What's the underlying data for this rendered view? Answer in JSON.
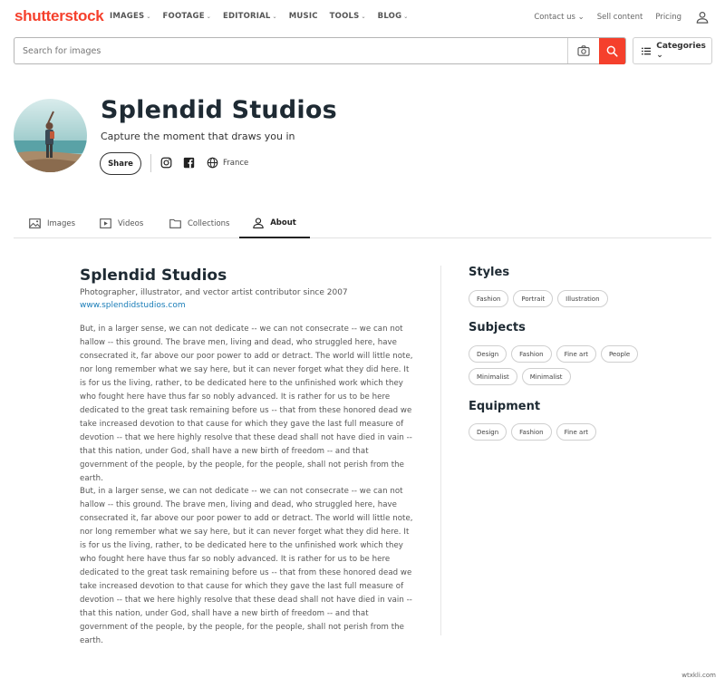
{
  "nav": {
    "logo": "shutterstock",
    "links": [
      {
        "label": "IMAGES",
        "caret": "⌄"
      },
      {
        "label": "FOOTAGE",
        "caret": "⌄"
      },
      {
        "label": "EDITORIAL",
        "caret": "⌄"
      },
      {
        "label": "MUSIC",
        "caret": ""
      },
      {
        "label": "TOOLS",
        "caret": "⌄"
      },
      {
        "label": "BLOG",
        "caret": "⌄"
      }
    ],
    "right": {
      "contact": "Contact us ⌄",
      "sell": "Sell content",
      "pricing": "Pricing"
    },
    "user_icon": "user-icon"
  },
  "search": {
    "placeholder": "Search for images",
    "camera_icon": "camera-search-icon",
    "search_icon": "search-icon"
  },
  "categories": {
    "label": "Categories ⌄",
    "icon": "list-icon"
  },
  "profile": {
    "name": "Splendid Studios",
    "tagline": "Capture the moment that draws you in",
    "share_label": "Share",
    "country": "France",
    "social_icons": [
      "instagram-icon",
      "facebook-icon",
      "globe-icon"
    ]
  },
  "tabs": [
    {
      "label": "Images",
      "icon": "image-icon"
    },
    {
      "label": "Videos",
      "icon": "video-icon"
    },
    {
      "label": "Collections",
      "icon": "folder-icon"
    },
    {
      "label": "About",
      "icon": "person-icon",
      "active": true
    }
  ],
  "about": {
    "name": "Splendid Studios",
    "subtitle": "Photographer, illustrator, and vector artist contributor since 2007",
    "website": "www.splendidstudios.com",
    "paragraphs": [
      "But, in a larger sense, we can not dedicate -- we can not consecrate -- we can not hallow -- this ground. The brave men, living and dead, who struggled here, have consecrated it, far above our poor power to add or detract. The world will little note, nor long remember what we say here, but it can never forget what they did here. It is for us the living, rather, to be dedicated here to the unfinished work which they who fought here have thus far so nobly advanced. It is rather for us to be here dedicated to the great task remaining before us -- that from these honored dead we take increased devotion to that cause for which they gave the last full measure of devotion -- that we here highly resolve that these dead shall not have died in vain -- that this nation, under God, shall have a new birth of freedom -- and that government of the people, by the people, for the people, shall not perish from the earth.",
      "But, in a larger sense, we can not dedicate -- we can not consecrate -- we can not hallow -- this ground. The brave men, living and dead, who struggled here, have consecrated it, far above our poor power to add or detract. The world will little note, nor long remember what we say here, but it can never forget what they did here. It is for us the living, rather, to be dedicated here to the unfinished work which they who fought here have thus far so nobly advanced. It is rather for us to be here dedicated to the great task remaining before us -- that from these honored dead we take increased devotion to that cause for which they gave the last full measure of devotion -- that we here highly resolve that these dead shall not have died in vain -- that this nation, under God, shall have a new birth of freedom -- and that government of the people, by the people, for the people, shall not perish from the earth."
    ]
  },
  "sidebar": {
    "styles_title": "Styles",
    "styles": [
      "Fashion",
      "Portrait",
      "Illustration"
    ],
    "subjects_title": "Subjects",
    "subjects_row1": [
      "Design",
      "Fashion",
      "Fine art",
      "People"
    ],
    "subjects_row2": [
      "Minimalist",
      "Minimalist"
    ],
    "equipment_title": "Equipment",
    "equipment": [
      "Design",
      "Fashion",
      "Fine art"
    ]
  },
  "watermark": "wtxkli.com",
  "colors": {
    "brand": "#f5402c",
    "link": "#1a7db8",
    "heading": "#1e2a33"
  }
}
